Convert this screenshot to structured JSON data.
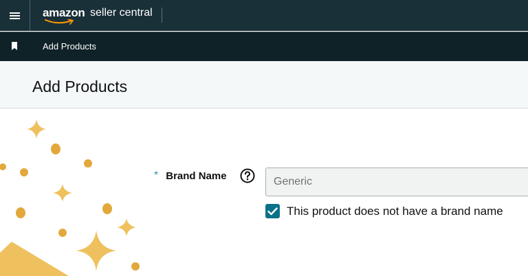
{
  "topbar": {
    "menu_icon": "hamburger-menu-icon",
    "logo_amazon": "amazon",
    "logo_suffix": "seller central"
  },
  "subbar": {
    "bookmark_icon": "bookmark-icon",
    "breadcrumb": "Add Products"
  },
  "page": {
    "title": "Add Products"
  },
  "form": {
    "required_marker": "*",
    "brand_label": "Brand Name",
    "help_icon": "question-circle-icon",
    "brand_value": "Generic",
    "no_brand_checked": true,
    "no_brand_label": "This product does not have a brand name"
  },
  "colors": {
    "topbar": "#1a3038",
    "subbar": "#0f2228",
    "accent": "#0b7189",
    "decor_gold": "#eec15e",
    "decor_dark_gold": "#e3a83b"
  }
}
